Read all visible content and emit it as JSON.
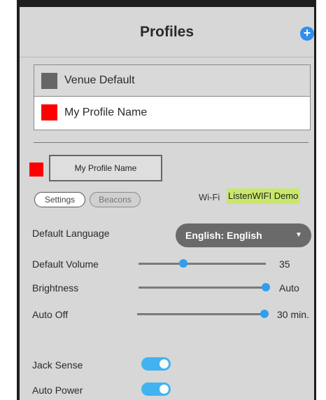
{
  "header": {
    "title": "Profiles",
    "add_icon": "plus-circle-icon",
    "add_glyph": "+"
  },
  "profiles": [
    {
      "label": "Venue Default",
      "color": "#666666"
    },
    {
      "label": "My Profile Name",
      "color": "#ff0000"
    }
  ],
  "current_profile": {
    "name": "My Profile Name",
    "color": "#ff0000"
  },
  "tabs": {
    "settings": "Settings",
    "beacons": "Beacons",
    "active": "Settings"
  },
  "wifi": {
    "label": "Wi-Fi",
    "network": "ListenWIFI Demo"
  },
  "settings": {
    "language": {
      "label": "Default Language",
      "value": "English: English",
      "arrow": "▼"
    },
    "volume": {
      "label": "Default Volume",
      "value": "35",
      "level": 0.35
    },
    "brightness": {
      "label": "Brightness",
      "value": "Auto",
      "level": 1.0
    },
    "auto_off": {
      "label": "Auto Off",
      "value": "30 min.",
      "level": 1.0
    },
    "jack_sense": {
      "label": "Jack Sense",
      "on": true
    },
    "auto_power": {
      "label": "Auto Power",
      "on": true
    }
  },
  "colors": {
    "accent": "#2d9ff0",
    "wifi_highlight": "#c9e86b",
    "toggle_on": "#42b3f0"
  }
}
